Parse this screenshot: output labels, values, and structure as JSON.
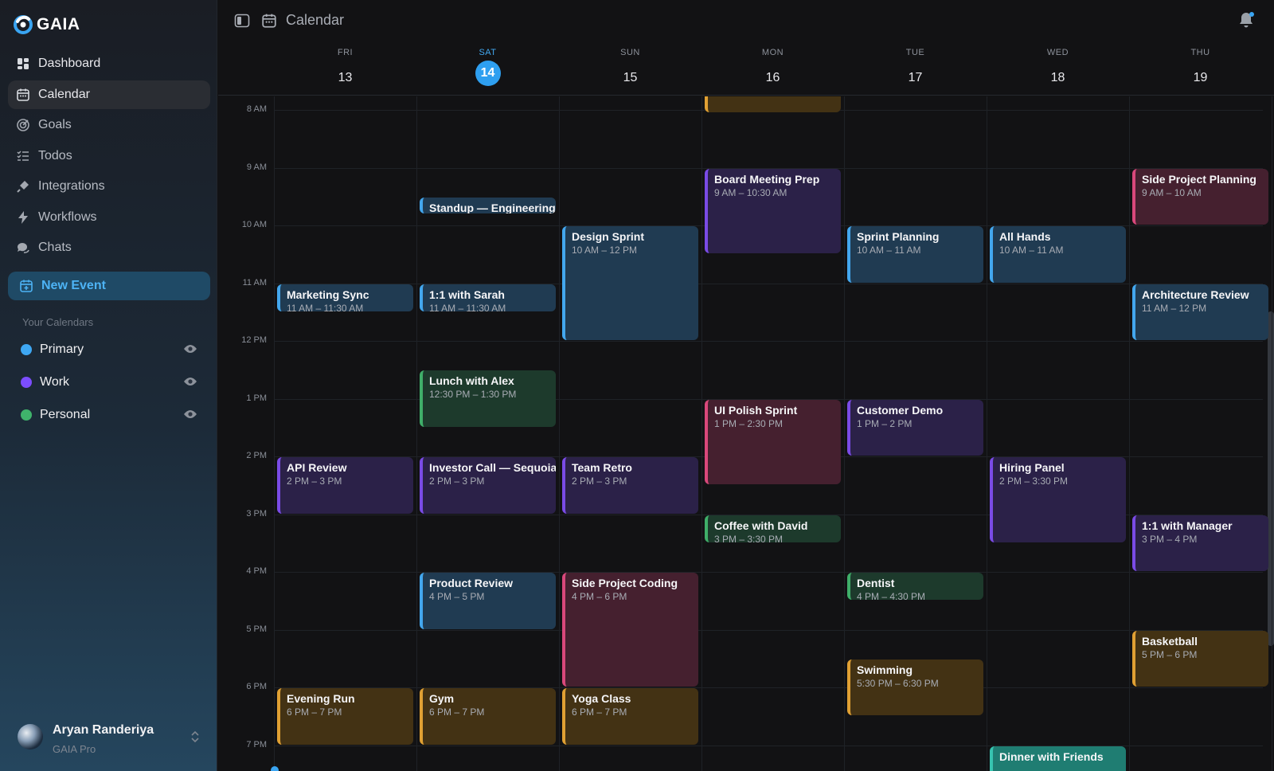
{
  "app": {
    "brand": "GAIA"
  },
  "sidebar": {
    "nav": [
      {
        "label": "Dashboard",
        "icon": "dashboard-icon"
      },
      {
        "label": "Calendar",
        "icon": "calendar-icon",
        "active": true
      },
      {
        "label": "Goals",
        "icon": "goal-icon"
      },
      {
        "label": "Todos",
        "icon": "checklist-icon"
      },
      {
        "label": "Integrations",
        "icon": "plug-icon"
      },
      {
        "label": "Workflows",
        "icon": "lightning-icon"
      },
      {
        "label": "Chats",
        "icon": "chat-icon"
      }
    ],
    "new_event_label": "New Event",
    "calendars_heading": "Your Calendars",
    "calendars": [
      {
        "name": "Primary",
        "color": "#3ea7f2",
        "visible": true
      },
      {
        "name": "Work",
        "color": "#7c4dff",
        "visible": true
      },
      {
        "name": "Personal",
        "color": "#3fb36b",
        "visible": true
      }
    ],
    "user": {
      "name": "Aryan Randeriya",
      "plan": "GAIA Pro"
    }
  },
  "topbar": {
    "title": "Calendar"
  },
  "days": [
    {
      "name": "FRI",
      "num": "13"
    },
    {
      "name": "SAT",
      "num": "14",
      "today": true
    },
    {
      "name": "SUN",
      "num": "15"
    },
    {
      "name": "MON",
      "num": "16"
    },
    {
      "name": "TUE",
      "num": "17"
    },
    {
      "name": "WED",
      "num": "18"
    },
    {
      "name": "THU",
      "num": "19"
    }
  ],
  "time_labels": [
    "8 AM",
    "9 AM",
    "10 AM",
    "11 AM",
    "12 PM",
    "1 PM",
    "2 PM",
    "3 PM",
    "4 PM",
    "5 PM",
    "6 PM",
    "7 PM"
  ],
  "events": [
    {
      "title": "Marketing Sync",
      "time": "11 AM – 11:30 AM",
      "day": 0,
      "start": 11,
      "end": 11.5,
      "color": "primary"
    },
    {
      "title": "API Review",
      "time": "2 PM – 3 PM",
      "day": 0,
      "start": 14,
      "end": 15,
      "color": "work"
    },
    {
      "title": "Evening Run",
      "time": "6 PM – 7 PM",
      "day": 0,
      "start": 18,
      "end": 19,
      "color": "amber"
    },
    {
      "title": "Standup — Engineering",
      "time": "",
      "day": 1,
      "start": 9.5,
      "end": 9.8,
      "color": "primary"
    },
    {
      "title": "1:1 with Sarah",
      "time": "11 AM – 11:30 AM",
      "day": 1,
      "start": 11,
      "end": 11.5,
      "color": "primary"
    },
    {
      "title": "Lunch with Alex",
      "time": "12:30 PM – 1:30 PM",
      "day": 1,
      "start": 12.5,
      "end": 13.5,
      "color": "personal"
    },
    {
      "title": "Investor Call — Sequoia",
      "time": "2 PM – 3 PM",
      "day": 1,
      "start": 14,
      "end": 15,
      "color": "work"
    },
    {
      "title": "Product Review",
      "time": "4 PM – 5 PM",
      "day": 1,
      "start": 16,
      "end": 17,
      "color": "primary"
    },
    {
      "title": "Gym",
      "time": "6 PM – 7 PM",
      "day": 1,
      "start": 18,
      "end": 19,
      "color": "amber"
    },
    {
      "title": "Design Sprint",
      "time": "10 AM – 12 PM",
      "day": 2,
      "start": 10,
      "end": 12,
      "color": "primary"
    },
    {
      "title": "Team Retro",
      "time": "2 PM – 3 PM",
      "day": 2,
      "start": 14,
      "end": 15,
      "color": "work"
    },
    {
      "title": "Side Project Coding",
      "time": "4 PM – 6 PM",
      "day": 2,
      "start": 16,
      "end": 18,
      "color": "pink"
    },
    {
      "title": "Yoga Class",
      "time": "6 PM – 7 PM",
      "day": 2,
      "start": 18,
      "end": 19,
      "color": "amber"
    },
    {
      "title": "",
      "time": "",
      "day": 3,
      "start": 7.5,
      "end": 8.05,
      "color": "amber"
    },
    {
      "title": "Board Meeting Prep",
      "time": "9 AM – 10:30 AM",
      "day": 3,
      "start": 9,
      "end": 10.5,
      "color": "work"
    },
    {
      "title": "UI Polish Sprint",
      "time": "1 PM – 2:30 PM",
      "day": 3,
      "start": 13,
      "end": 14.5,
      "color": "pink"
    },
    {
      "title": "Coffee with David",
      "time": "3 PM – 3:30 PM",
      "day": 3,
      "start": 15,
      "end": 15.5,
      "color": "personal"
    },
    {
      "title": "Sprint Planning",
      "time": "10 AM – 11 AM",
      "day": 4,
      "start": 10,
      "end": 11,
      "color": "primary"
    },
    {
      "title": "Customer Demo",
      "time": "1 PM – 2 PM",
      "day": 4,
      "start": 13,
      "end": 14,
      "color": "work"
    },
    {
      "title": "Dentist",
      "time": "4 PM – 4:30 PM",
      "day": 4,
      "start": 16,
      "end": 16.5,
      "color": "personal"
    },
    {
      "title": "Swimming",
      "time": "5:30 PM – 6:30 PM",
      "day": 4,
      "start": 17.5,
      "end": 18.5,
      "color": "amber"
    },
    {
      "title": "All Hands",
      "time": "10 AM – 11 AM",
      "day": 5,
      "start": 10,
      "end": 11,
      "color": "primary"
    },
    {
      "title": "Hiring Panel",
      "time": "2 PM – 3:30 PM",
      "day": 5,
      "start": 14,
      "end": 15.5,
      "color": "work"
    },
    {
      "title": "Dinner with Friends",
      "time": "",
      "day": 5,
      "start": 19,
      "end": 20,
      "color": "teal"
    },
    {
      "title": "Side Project Planning",
      "time": "9 AM – 10 AM",
      "day": 6,
      "start": 9,
      "end": 10,
      "color": "pink"
    },
    {
      "title": "Architecture Review",
      "time": "11 AM – 12 PM",
      "day": 6,
      "start": 11,
      "end": 12,
      "color": "primary"
    },
    {
      "title": "1:1 with Manager",
      "time": "3 PM – 4 PM",
      "day": 6,
      "start": 15,
      "end": 16,
      "color": "work"
    },
    {
      "title": "Basketball",
      "time": "5 PM – 6 PM",
      "day": 6,
      "start": 17,
      "end": 18,
      "color": "amber"
    }
  ]
}
